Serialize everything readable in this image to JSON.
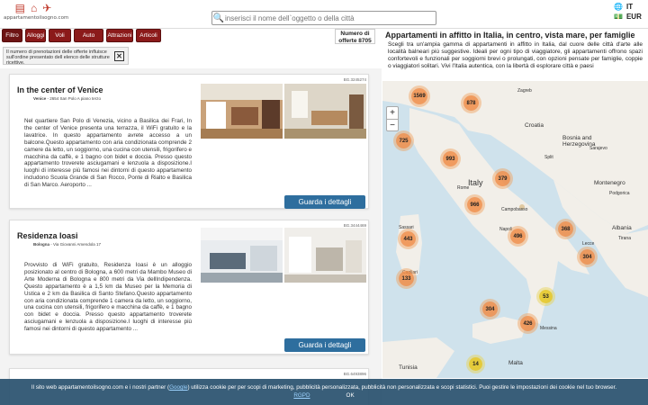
{
  "header": {
    "logo_text": "appartamentoilsogno.com",
    "search_placeholder": "inserisci il nome dell`oggetto o della città",
    "lang": "IT",
    "currency": "EUR"
  },
  "filters": [
    "Filtro",
    "Alloggi",
    "Voli",
    "Auto",
    "Attrazioni",
    "Articoli"
  ],
  "offer_count": {
    "label": "Numero di",
    "label2": "offerte",
    "value": "8705"
  },
  "notice": {
    "text": "Il numero di prenotazioni delle offerte influisce sull'ordine presentato dell elenco delle strutture ricettive.",
    "close": "✕"
  },
  "listings": [
    {
      "code": "BG.3245274",
      "title": "In the center of Venice",
      "city": "Venice",
      "address": " - 2654 San Polo A piano terzo",
      "description": "Nel quartiere San Polo di Venezia, vicino a Basilica dei Frari, In the center of Venice presenta una terrazza, il WiFi gratuito e la lavatrice. In questo appartamento avrete accesso a un balcone.Questo appartamento con aria condizionata comprende 2 camere da letto, un soggiorno, una cucina con utensili, frigorifero e macchina da caffè, e 1 bagno con bidet e doccia. Presso questo appartamento troverete asciugamani e lenzuola a disposizione.I luoghi di interesse più famosi nei dintorni di questo appartamento includono Scuola Grande di San Rocco, Ponte di Rialto e Basilica di San Marco. Aeroporto ...",
      "button": "Guarda i dettagli"
    },
    {
      "code": "BG.3444469",
      "title": "Residenza Ioasi",
      "city": "Bologna",
      "address": " - Via Giovanni Amendola 17",
      "description": "Provvisto di WiFi gratuito, Residenza Ioasi è un alloggio posizionato al centro di Bologna, a 600 metri da Mambo Museo di Arte Moderna di Bologna e 800 metri da Via dellIndipendenza. Questo appartamento è a 1,5 km da Museo per la Memoria di Ustica e 2 km da Basilica di Santo Stefano.Questo appartamento con aria condizionata comprende 1 camera da letto, un soggiorno, una cucina con utensili, frigorifero e macchina da caffè, e 1 bagno con bidet e doccia. Presso questo appartamento troverete asciugamani e lenzuola a disposizione.I luoghi di interesse più famosi nei dintorni di questo appartamento ...",
      "button": "Guarda i dettagli"
    },
    {
      "code": "BG.6493896"
    }
  ],
  "right_panel": {
    "title": "Appartamenti in affitto in Italia, in centro, vista mare, per famiglie",
    "text": "Scegli tra un'ampia gamma di appartamenti in affitto in Italia, dal cuore delle città d'arte alle località balneari più suggestive. Ideali per ogni tipo di viaggiatore, gli appartamenti offrono spazi confortevoli e funzionali per soggiorni brevi o prolungati, con opzioni pensate per famiglie, coppie o viaggiatori solitari. Vivi l'Italia autentica, con la libertà di esplorare città e paesi"
  },
  "map": {
    "zoom_in": "+",
    "zoom_out": "−",
    "labels": [
      "Italy",
      "Croatia",
      "Bosnia and Herzegovina",
      "Montenegro",
      "Albania",
      "Tunisia",
      "Malta",
      "Rome",
      "Campobasso",
      "Napoli",
      "Lecce",
      "Messina",
      "Zagreb",
      "Sarajevo",
      "Split",
      "Podgorica",
      "Tirana",
      "Sassari",
      "Cagliari"
    ],
    "clusters": [
      "1569",
      "878",
      "725",
      "993",
      "379",
      "966",
      "443",
      "496",
      "368",
      "304",
      "133",
      "304",
      "53",
      "426",
      "14"
    ]
  },
  "cookie": {
    "text1": "Il sito web appartamentoilsogno.com e i nostri partner (",
    "link": "Google",
    "text2": ") utilizza cookie per per scopi di marketing, pubblicità personalizzata, pubblicità non personalizzata e scopi statistici. Puoi gestire le impostazioni dei cookie nel tuo browser.",
    "rgpd": "RGPD",
    "ok": "OK"
  }
}
